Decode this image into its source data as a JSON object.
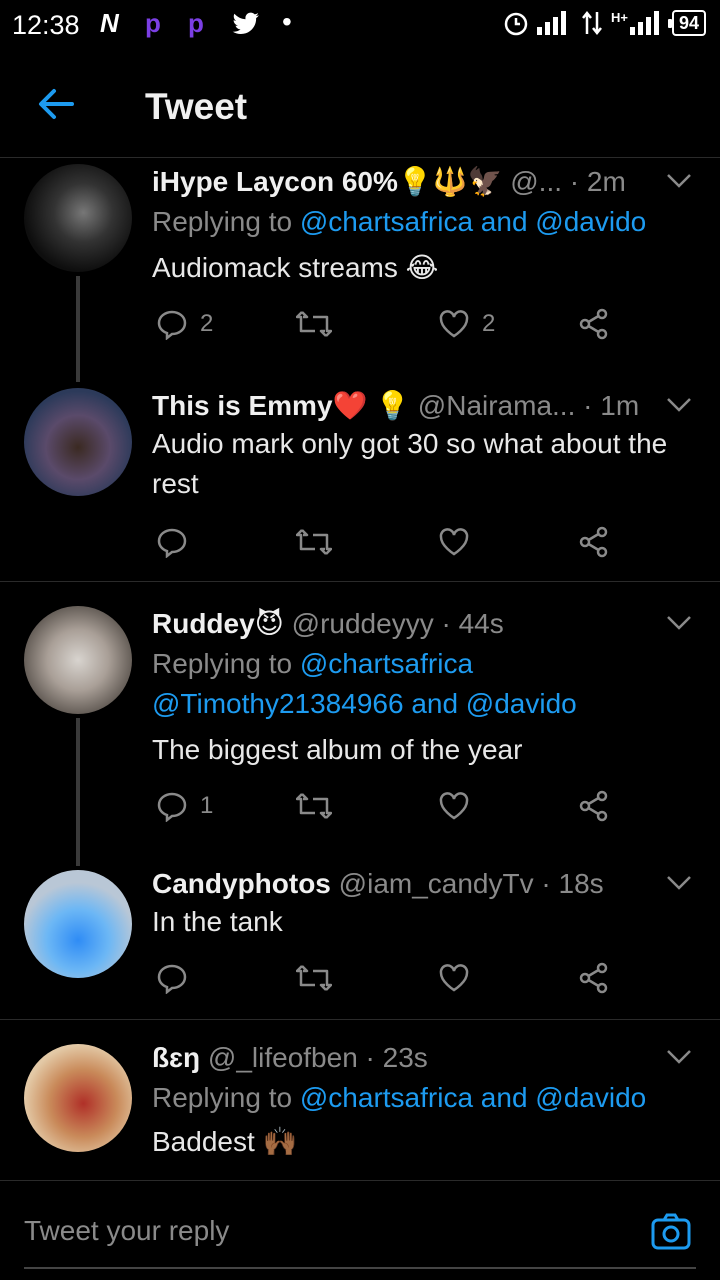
{
  "status_bar": {
    "time": "12:38",
    "icons": [
      "N",
      "P",
      "P",
      "twitter-bird",
      "•"
    ],
    "battery": "94",
    "network": "H+"
  },
  "header": {
    "title": "Tweet"
  },
  "tweets": [
    {
      "name": "iHype Laycon 60%💡🔱🦅",
      "handle": "@...",
      "time": "· 2m",
      "replying_label": "Replying to",
      "replying_links": "@chartsafrica and @davido",
      "text": "Audiomack streams 😂",
      "reply_count": "2",
      "retweet_count": "",
      "like_count": "2"
    },
    {
      "name": "This is Emmy❤️ 💡",
      "handle": "@Nairama...",
      "time": "· 1m",
      "text": "Audio mark only got 30 so what about the rest",
      "reply_count": "",
      "retweet_count": "",
      "like_count": ""
    },
    {
      "name": "Ruddey😈",
      "handle": "@ruddeyyy",
      "time": "· 44s",
      "replying_label": "Replying to",
      "replying_links_line1": "@chartsafrica",
      "replying_links_line2": "@Timothy21384966 and @davido",
      "text": "The biggest album of the year",
      "reply_count": "1",
      "retweet_count": "",
      "like_count": ""
    },
    {
      "name": "Candyphotos",
      "handle": "@iam_candyTv",
      "time": "· 18s",
      "text": "In the tank",
      "reply_count": "",
      "retweet_count": "",
      "like_count": ""
    },
    {
      "name": "ßɛŋ",
      "handle": "@_lifeofben",
      "time": "· 23s",
      "replying_label": "Replying to",
      "replying_links": "@chartsafrica and @davido",
      "text": "Baddest 🙌🏾"
    }
  ],
  "reply_bar": {
    "placeholder": "Tweet your reply"
  },
  "colors": {
    "accent": "#1d9bf0",
    "background": "#000000",
    "muted": "#8a8a8a"
  }
}
